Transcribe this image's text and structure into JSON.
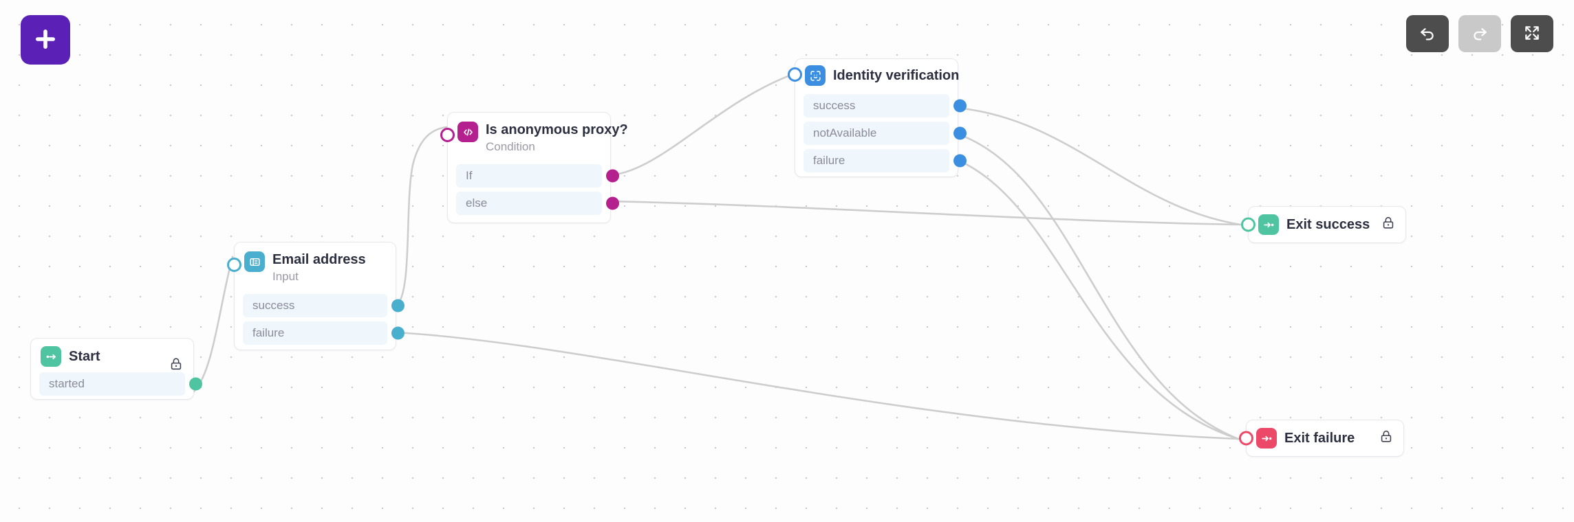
{
  "toolbar": {
    "add_label": "+",
    "add_icon": "plus-icon",
    "undo_icon": "undo-arrow-icon",
    "redo_icon": "redo-arrow-icon",
    "fullscreen_icon": "fullscreen-expand-icon",
    "accent_purple": "#5b21b6",
    "button_dark": "#4d4d4d",
    "button_disabled": "#c9c9c9"
  },
  "canvas": {
    "background": "#fdfdfd",
    "grid_dot_color": "#c9c9cd",
    "edge_color": "#cdcdcd"
  },
  "nodes": {
    "start": {
      "title": "Start",
      "icon": "start-arrow-icon",
      "color": "#4fc4a0",
      "locked": true,
      "lock_icon": "lock-icon",
      "ports": [
        {
          "label": "started",
          "color": "#4fc4a0"
        }
      ]
    },
    "email": {
      "title": "Email address",
      "subtitle": "Input",
      "icon": "input-field-icon",
      "color": "#4aafce",
      "input_color": "#4aafce",
      "ports": [
        {
          "label": "success",
          "color": "#4aafce"
        },
        {
          "label": "failure",
          "color": "#4aafce"
        }
      ]
    },
    "proxy": {
      "title": "Is anonymous proxy?",
      "subtitle": "Condition",
      "icon": "code-brackets-icon",
      "color": "#b4218f",
      "input_color": "#b4218f",
      "ports": [
        {
          "label": "If",
          "color": "#b4218f"
        },
        {
          "label": "else",
          "color": "#b4218f"
        }
      ]
    },
    "identity": {
      "title": "Identity verification",
      "subtitle": "",
      "icon": "face-scan-icon",
      "color": "#3c8ee0",
      "input_color": "#3c8ee0",
      "ports": [
        {
          "label": "success",
          "color": "#3c8ee0"
        },
        {
          "label": "notAvailable",
          "color": "#3c8ee0"
        },
        {
          "label": "failure",
          "color": "#3c8ee0"
        }
      ]
    },
    "exit_success": {
      "title": "Exit success",
      "icon": "exit-arrow-icon",
      "color": "#4fc4a0",
      "input_color": "#4fc4a0",
      "locked": true,
      "lock_icon": "lock-icon"
    },
    "exit_failure": {
      "title": "Exit failure",
      "icon": "exit-arrow-icon",
      "color": "#ec4868",
      "input_color": "#ec4868",
      "locked": true,
      "lock_icon": "lock-icon"
    }
  },
  "edges": [
    {
      "from": "start.started",
      "to": "email.input"
    },
    {
      "from": "email.success",
      "to": "proxy.input"
    },
    {
      "from": "email.failure",
      "to": "exit_failure.input"
    },
    {
      "from": "proxy.If",
      "to": "identity.input"
    },
    {
      "from": "proxy.else",
      "to": "exit_success.input"
    },
    {
      "from": "identity.success",
      "to": "exit_success.input"
    },
    {
      "from": "identity.notAvailable",
      "to": "exit_failure.input"
    },
    {
      "from": "identity.failure",
      "to": "exit_failure.input"
    }
  ]
}
